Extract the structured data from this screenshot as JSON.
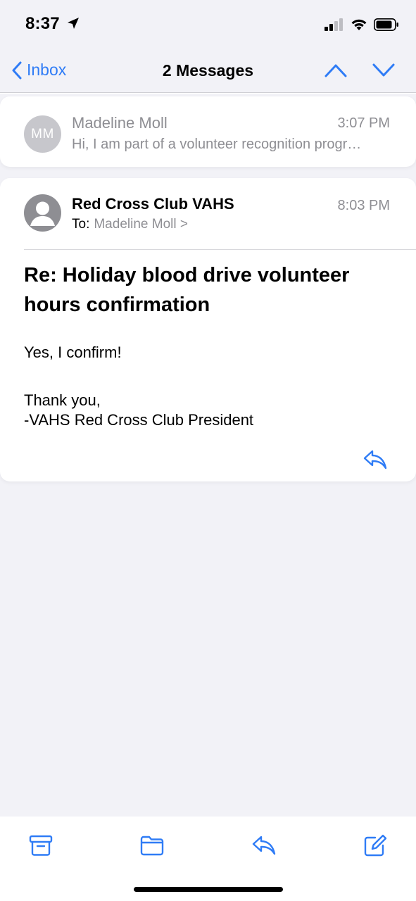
{
  "status_bar": {
    "time": "8:37"
  },
  "nav": {
    "back_label": "Inbox",
    "title": "2 Messages"
  },
  "messages": [
    {
      "initials": "MM",
      "sender": "Madeline Moll",
      "time": "3:07 PM",
      "preview": "Hi, I am part of a volunteer recognition progr…"
    },
    {
      "sender": "Red Cross Club VAHS",
      "time": "8:03 PM",
      "to_label": "To:",
      "to_recipient": "Madeline Moll >",
      "subject": "Re: Holiday blood drive volunteer hours confirmation",
      "body_line1": "Yes, I confirm!",
      "body_line2": "Thank you,",
      "body_line3": "-VAHS Red Cross Club President"
    }
  ],
  "colors": {
    "accent": "#2f7cf6",
    "secondary_text": "#8e8e93",
    "background": "#f2f2f7"
  },
  "icons": {
    "status": [
      "location-arrow-icon",
      "cellular-signal-icon",
      "wifi-icon",
      "battery-icon"
    ],
    "nav": [
      "chevron-left-icon",
      "chevron-up-icon",
      "chevron-down-icon"
    ],
    "toolbar": [
      "archive-icon",
      "folder-icon",
      "reply-icon",
      "compose-icon"
    ]
  }
}
